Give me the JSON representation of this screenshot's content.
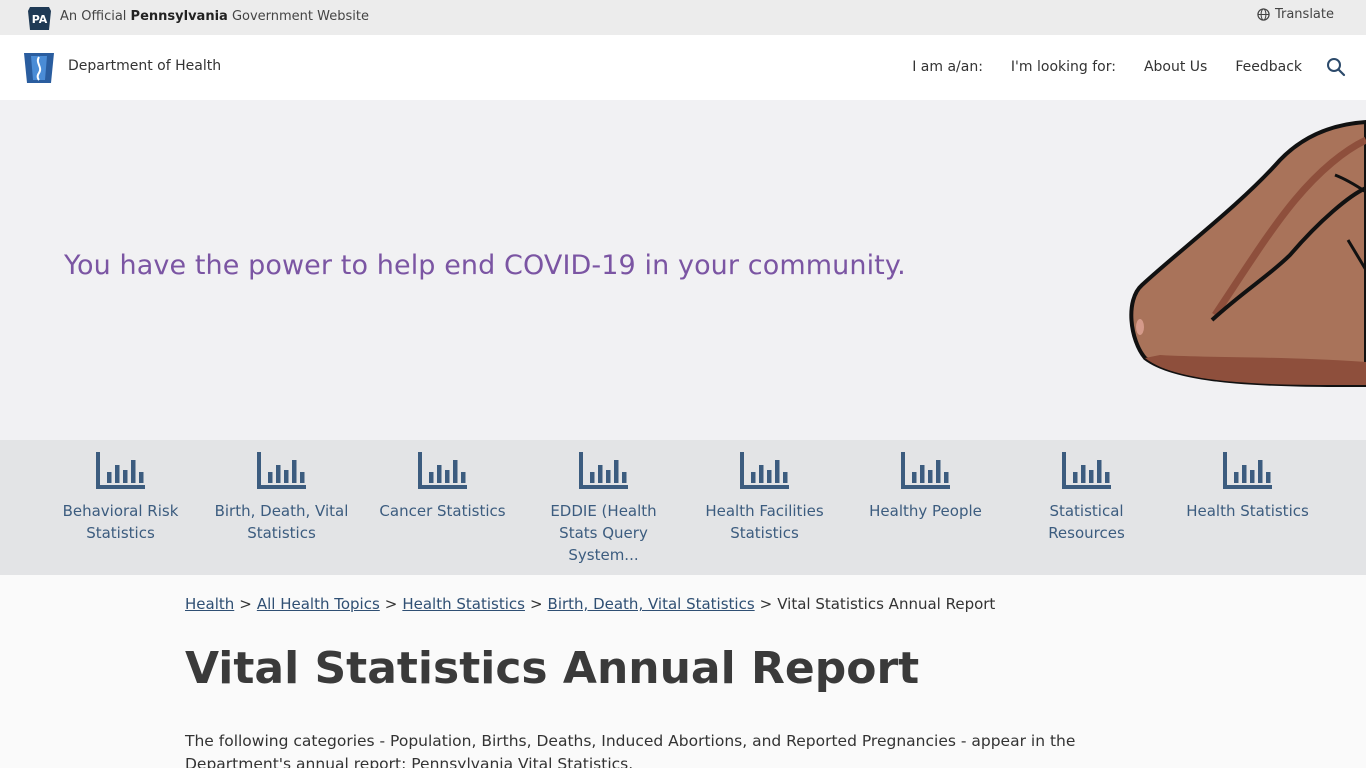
{
  "gov_banner": {
    "seal_text": "PA",
    "prefix": "An Official ",
    "state": "Pennsylvania",
    "suffix": " Government Website",
    "translate": "Translate"
  },
  "header": {
    "department": "Department of Health",
    "nav": [
      "I am a/an:",
      "I'm looking for:",
      "About Us",
      "Feedback"
    ]
  },
  "hero": {
    "headline": "You have the power to help end COVID-19 in your community."
  },
  "stat_tiles": [
    {
      "label": "Behavioral Risk Statistics"
    },
    {
      "label": "Birth, Death, Vital Statistics"
    },
    {
      "label": "Cancer Statistics"
    },
    {
      "label": "EDDIE (Health Stats Query System..."
    },
    {
      "label": "Health Facilities Statistics"
    },
    {
      "label": "Healthy People"
    },
    {
      "label": "Statistical Resources"
    },
    {
      "label": "Health Statistics"
    }
  ],
  "breadcrumb": {
    "links": [
      "Health",
      "All Health Topics",
      "Health Statistics",
      "Birth, Death, Vital Statistics"
    ],
    "separator": ">",
    "current": "Vital Statistics Annual Report"
  },
  "page": {
    "title": "Vital Statistics Annual Report",
    "intro": "The following categories - Population, Births, Deaths, Induced Abortions, and Reported Pregnancies - appear in the Department's annual report: Pennsylvania Vital Statistics."
  },
  "colors": {
    "accent_purple": "#7b55a3",
    "link_blue": "#2f4f73",
    "icon_blue": "#3c5c7f"
  }
}
